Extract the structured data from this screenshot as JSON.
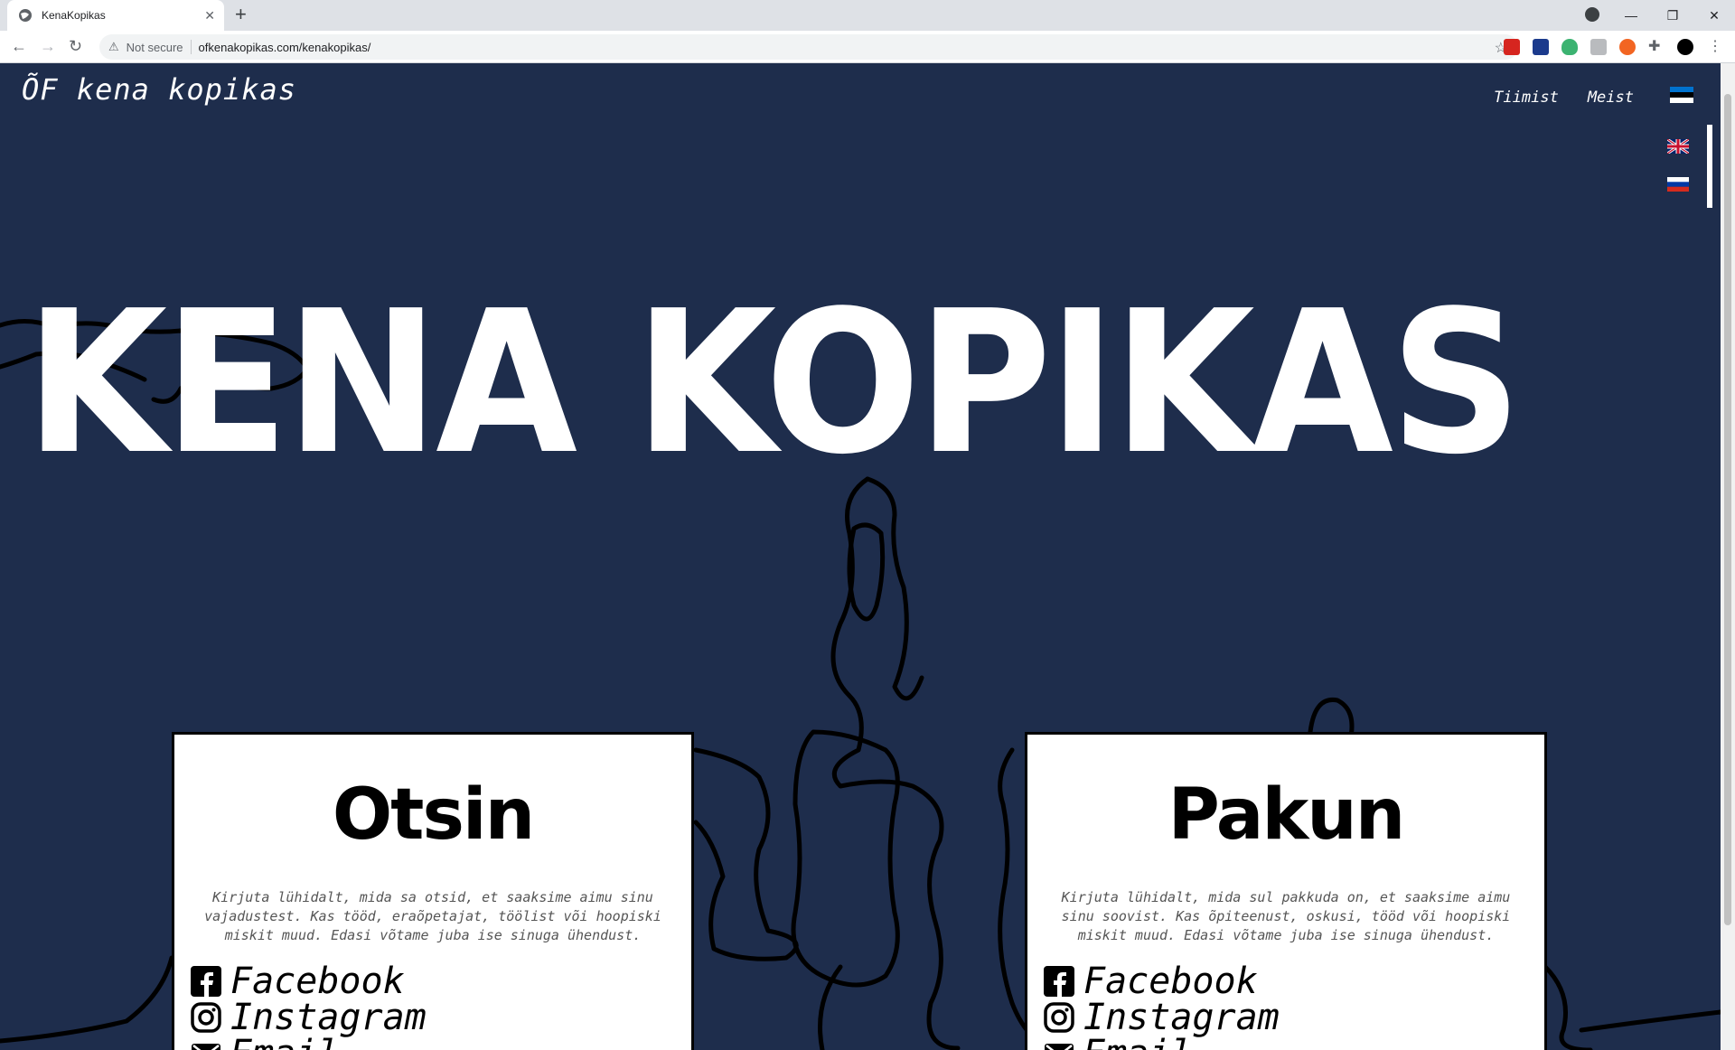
{
  "browser": {
    "tab_title": "KenaKopikas",
    "tab_close": "✕",
    "new_tab": "+",
    "security_label": "Not secure",
    "url": "ofkenakopikas.com/kenakopikas/",
    "win_min": "—",
    "win_restore": "❐",
    "win_close": "✕"
  },
  "site": {
    "brand": "ÕF kena kopikas",
    "nav": [
      "Tiimist",
      "Meist"
    ],
    "hero": "KENA KOPIKAS"
  },
  "cards": [
    {
      "title": "Otsin",
      "text": "Kirjuta lühidalt, mida sa otsid, et saaksime aimu sinu vajadustest. Kas tööd, eraõpetajat, töölist või hoopiski miskit muud. Edasi võtame juba ise sinuga ühendust.",
      "links": [
        "Facebook",
        "Instagram",
        "Email"
      ]
    },
    {
      "title": "Pakun",
      "text": "Kirjuta lühidalt, mida sul pakkuda on, et saaksime aimu sinu soovist. Kas õpiteenust, oskusi, tööd või hoopiski miskit muud. Edasi võtame juba ise sinuga ühendust.",
      "links": [
        "Facebook",
        "Instagram",
        "Email"
      ]
    }
  ],
  "colors": {
    "page_bg": "#1e2d4c",
    "card_bg": "#ffffff",
    "text_light": "#ffffff"
  }
}
